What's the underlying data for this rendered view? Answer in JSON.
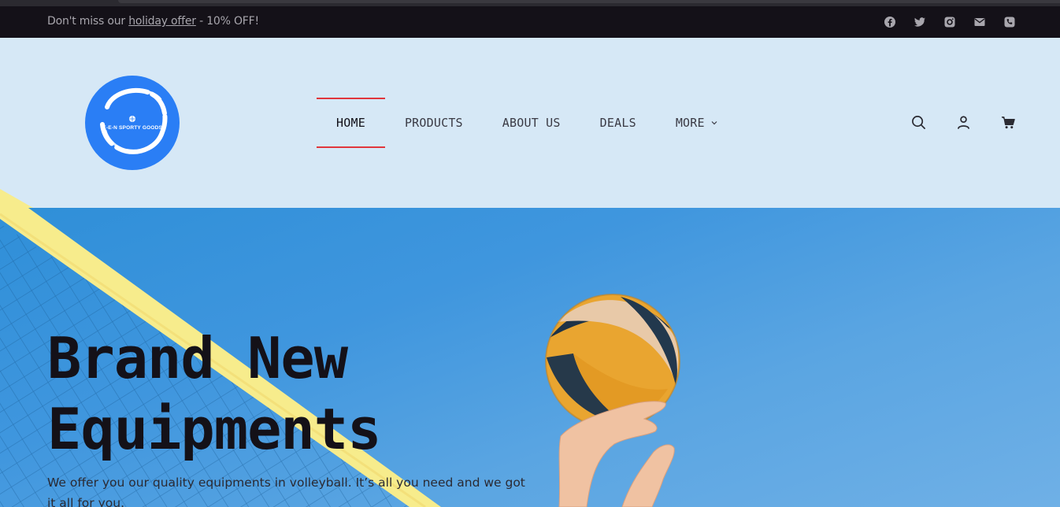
{
  "promo": {
    "prefix": "Don't miss our ",
    "link": "holiday offer",
    "suffix": " - 10% OFF!"
  },
  "social_icons": [
    "facebook-icon",
    "twitter-icon",
    "instagram-icon",
    "email-icon",
    "phone-icon"
  ],
  "logo": {
    "text": "K-E-N SPORTY GOODS"
  },
  "nav": {
    "items": [
      {
        "label": "HOME",
        "active": true
      },
      {
        "label": "PRODUCTS",
        "active": false
      },
      {
        "label": "ABOUT US",
        "active": false
      },
      {
        "label": "DEALS",
        "active": false
      },
      {
        "label": "MORE",
        "active": false
      }
    ]
  },
  "header_icons": [
    "search-icon",
    "user-icon",
    "cart-icon"
  ],
  "hero": {
    "title_line1": "Brand New",
    "title_line2": "Equipments",
    "subtitle": "We offer you our quality equipments in volleyball. It’s all you need and we got it all for you."
  },
  "colors": {
    "promo_bg": "#141118",
    "header_bg": "#d6e8f6",
    "logo_bg": "#2a7ef5",
    "nav_active_line": "#e0363c",
    "hero_sky": "#3f96de",
    "net_yellow": "#f7ec8c"
  }
}
